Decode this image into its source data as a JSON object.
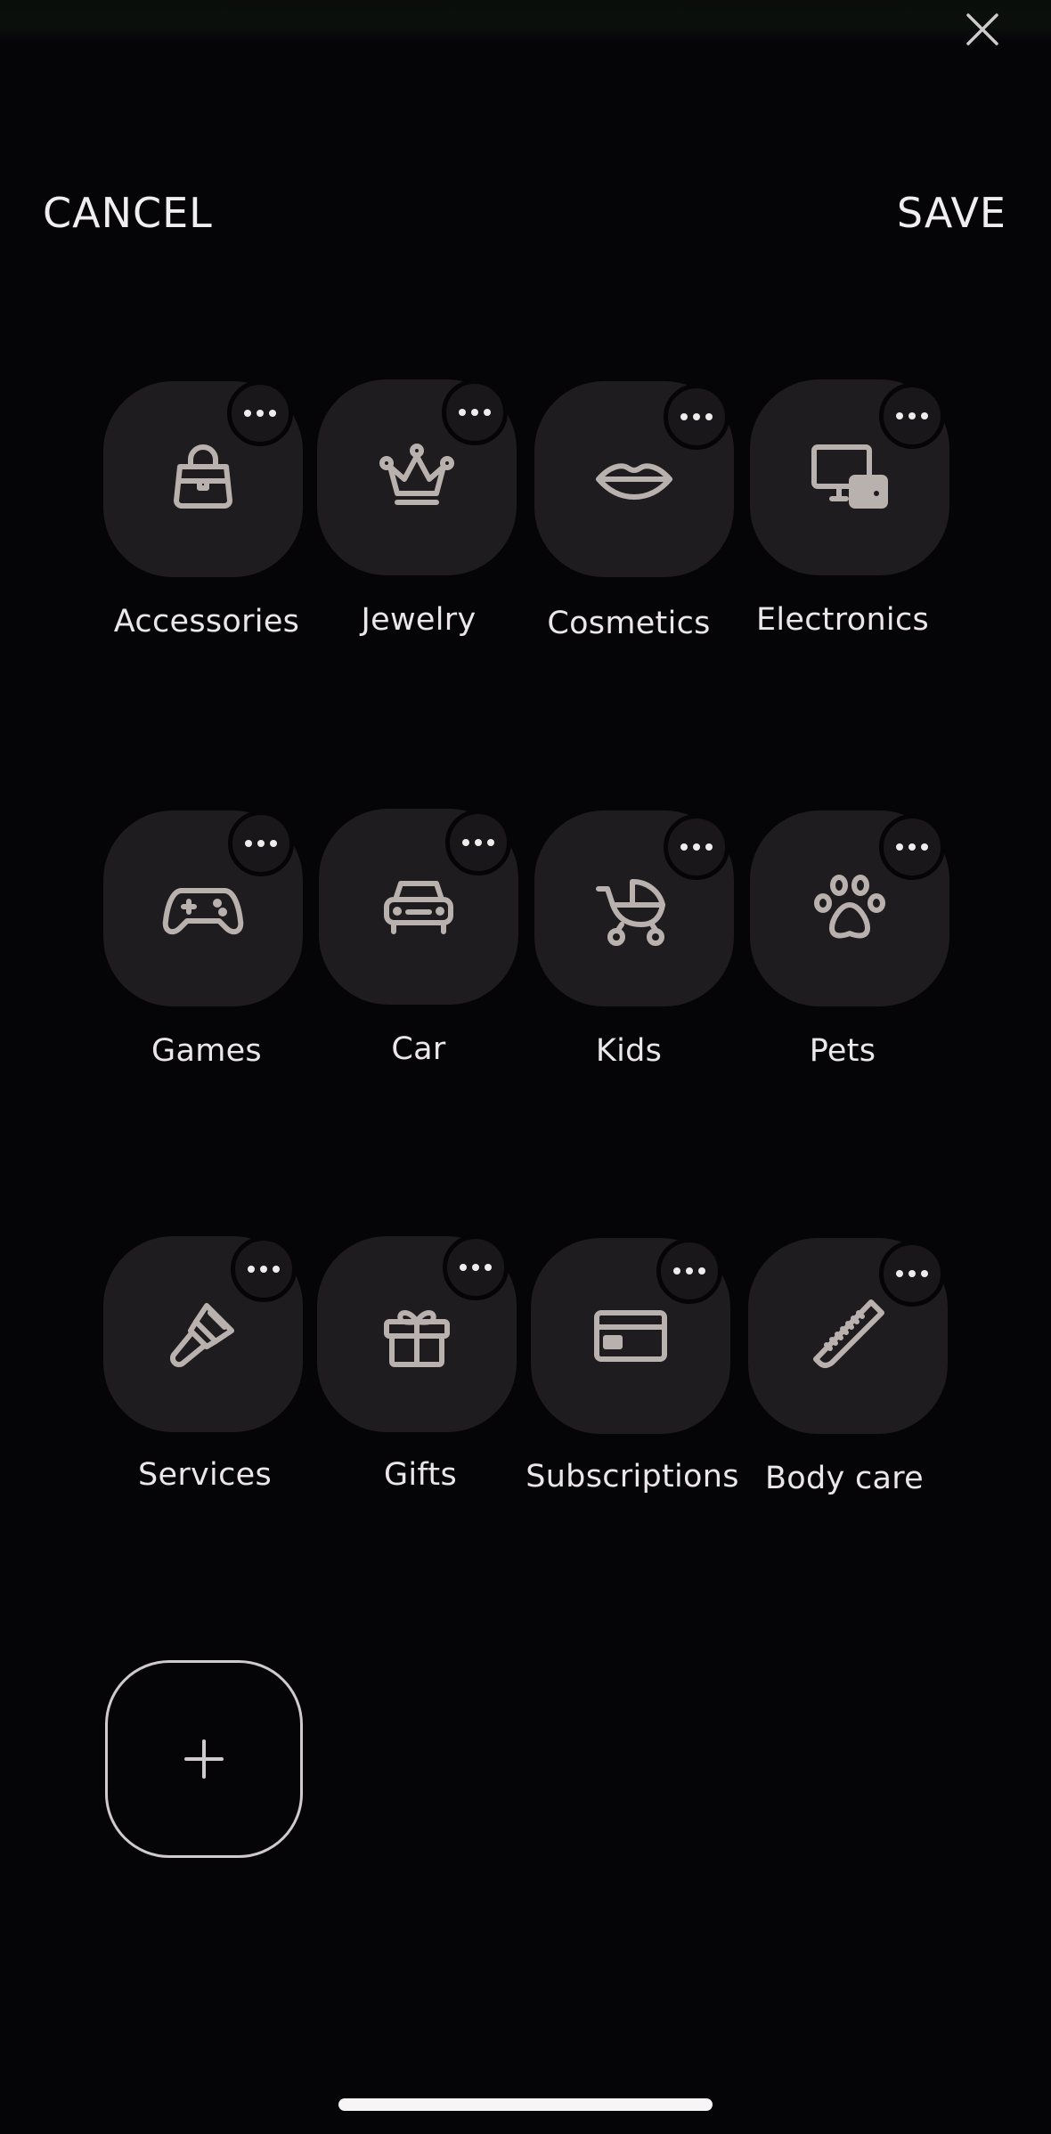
{
  "header": {
    "cancel_label": "CANCEL",
    "save_label": "SAVE"
  },
  "icon_color": "#b9b1ae",
  "tile_color": "#1e1c1f",
  "background_color": "#050407",
  "categories": [
    {
      "label": "Accessories",
      "icon": "handbag-icon"
    },
    {
      "label": "Jewelry",
      "icon": "crown-icon"
    },
    {
      "label": "Cosmetics",
      "icon": "lips-icon"
    },
    {
      "label": "Electronics",
      "icon": "devices-icon"
    },
    {
      "label": "Games",
      "icon": "gamepad-icon"
    },
    {
      "label": "Car",
      "icon": "car-icon"
    },
    {
      "label": "Kids",
      "icon": "stroller-icon"
    },
    {
      "label": "Pets",
      "icon": "paw-icon"
    },
    {
      "label": "Services",
      "icon": "paintbrush-icon"
    },
    {
      "label": "Gifts",
      "icon": "gift-icon"
    },
    {
      "label": "Subscriptions",
      "icon": "credit-card-icon"
    },
    {
      "label": "Body care",
      "icon": "comb-icon"
    }
  ],
  "add_button": {
    "icon": "plus-icon"
  }
}
